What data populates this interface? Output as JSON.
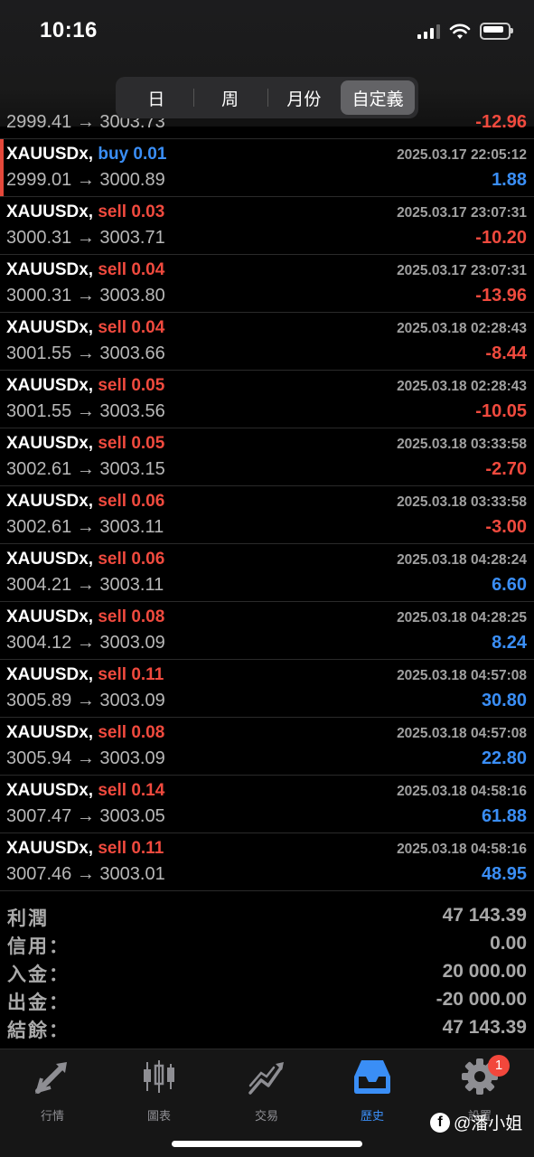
{
  "status_bar": {
    "time": "10:16"
  },
  "segmented": [
    {
      "label": "日",
      "active": false
    },
    {
      "label": "周",
      "active": false
    },
    {
      "label": "月份",
      "active": false
    },
    {
      "label": "自定義",
      "active": true
    }
  ],
  "partial_row": {
    "prices": "2999.41 → 3003.73",
    "profit": "-12.96"
  },
  "trades": [
    {
      "symbol": "XAUUSDx,",
      "type": "buy 0.01",
      "side": "buy",
      "datetime": "2025.03.17 22:05:12",
      "prices": "2999.01 → 3000.89",
      "profit": "1.88"
    },
    {
      "symbol": "XAUUSDx,",
      "type": "sell 0.03",
      "side": "sell",
      "datetime": "2025.03.17 23:07:31",
      "prices": "3000.31 → 3003.71",
      "profit": "-10.20"
    },
    {
      "symbol": "XAUUSDx,",
      "type": "sell 0.04",
      "side": "sell",
      "datetime": "2025.03.17 23:07:31",
      "prices": "3000.31 → 3003.80",
      "profit": "-13.96"
    },
    {
      "symbol": "XAUUSDx,",
      "type": "sell 0.04",
      "side": "sell",
      "datetime": "2025.03.18 02:28:43",
      "prices": "3001.55 → 3003.66",
      "profit": "-8.44"
    },
    {
      "symbol": "XAUUSDx,",
      "type": "sell 0.05",
      "side": "sell",
      "datetime": "2025.03.18 02:28:43",
      "prices": "3001.55 → 3003.56",
      "profit": "-10.05"
    },
    {
      "symbol": "XAUUSDx,",
      "type": "sell 0.05",
      "side": "sell",
      "datetime": "2025.03.18 03:33:58",
      "prices": "3002.61 → 3003.15",
      "profit": "-2.70"
    },
    {
      "symbol": "XAUUSDx,",
      "type": "sell 0.06",
      "side": "sell",
      "datetime": "2025.03.18 03:33:58",
      "prices": "3002.61 → 3003.11",
      "profit": "-3.00"
    },
    {
      "symbol": "XAUUSDx,",
      "type": "sell 0.06",
      "side": "sell",
      "datetime": "2025.03.18 04:28:24",
      "prices": "3004.21 → 3003.11",
      "profit": "6.60"
    },
    {
      "symbol": "XAUUSDx,",
      "type": "sell 0.08",
      "side": "sell",
      "datetime": "2025.03.18 04:28:25",
      "prices": "3004.12 → 3003.09",
      "profit": "8.24"
    },
    {
      "symbol": "XAUUSDx,",
      "type": "sell 0.11",
      "side": "sell",
      "datetime": "2025.03.18 04:57:08",
      "prices": "3005.89 → 3003.09",
      "profit": "30.80"
    },
    {
      "symbol": "XAUUSDx,",
      "type": "sell 0.08",
      "side": "sell",
      "datetime": "2025.03.18 04:57:08",
      "prices": "3005.94 → 3003.09",
      "profit": "22.80"
    },
    {
      "symbol": "XAUUSDx,",
      "type": "sell 0.14",
      "side": "sell",
      "datetime": "2025.03.18 04:58:16",
      "prices": "3007.47 → 3003.05",
      "profit": "61.88"
    },
    {
      "symbol": "XAUUSDx,",
      "type": "sell 0.11",
      "side": "sell",
      "datetime": "2025.03.18 04:58:16",
      "prices": "3007.46 → 3003.01",
      "profit": "48.95"
    }
  ],
  "summary": [
    {
      "label": "利潤",
      "value": "47 143.39"
    },
    {
      "label": "信用：",
      "value": "0.00"
    },
    {
      "label": "入金：",
      "value": "20 000.00"
    },
    {
      "label": "出金：",
      "value": "-20 000.00"
    },
    {
      "label": "結餘：",
      "value": "47 143.39"
    }
  ],
  "tabbar": [
    {
      "label": "行情",
      "icon": "quotes-icon",
      "active": false
    },
    {
      "label": "圖表",
      "icon": "chart-icon",
      "active": false
    },
    {
      "label": "交易",
      "icon": "trade-icon",
      "active": false
    },
    {
      "label": "歷史",
      "icon": "history-icon",
      "active": true
    },
    {
      "label": "設置",
      "icon": "settings-icon",
      "active": false,
      "badge": "1"
    }
  ],
  "watermark": {
    "text": "@潘小姐"
  },
  "colors": {
    "sell": "#f04a3e",
    "buy": "#3a8ef6",
    "accent": "#3a8ef6"
  }
}
